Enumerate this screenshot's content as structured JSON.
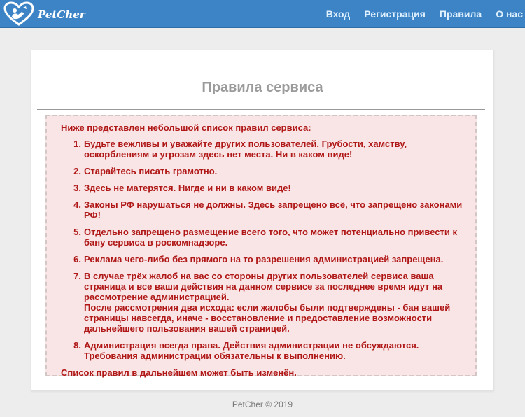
{
  "brand": {
    "name": "PetCher",
    "logo_icon": "heart-pet-logo"
  },
  "nav": {
    "links": [
      "Вход",
      "Регистрация",
      "Правила",
      "О нас"
    ]
  },
  "page": {
    "title": "Правила сервиса"
  },
  "rules": {
    "intro": "Ниже представлен небольшой список правил сервиса:",
    "items": [
      {
        "num": "1.",
        "text": "Будьте вежливы и уважайте других пользователей. Грубости, хамству, оскорблениям и угрозам здесь нет места. Ни в каком виде!"
      },
      {
        "num": "2.",
        "text": "Старайтесь писать грамотно."
      },
      {
        "num": "3.",
        "text": "Здесь не матерятся. Нигде и ни в каком виде!"
      },
      {
        "num": "4.",
        "text": "Законы РФ нарушаться не должны. Здесь запрещено всё, что запрещено законами РФ!"
      },
      {
        "num": "5.",
        "text": "Отдельно запрещено размещение всего того, что может потенциально привести к бану сервиса в роскомнадзоре."
      },
      {
        "num": "6.",
        "text": "Реклама чего-либо без прямого на то разрешения администрацией запрещена."
      },
      {
        "num": "7.",
        "text": "В случае трёх жалоб на вас со стороны других пользователей сервиса ваша страница и все ваши действия на данном сервисе за последнее время идут на рассмотрение администрацией.",
        "text2": "После рассмотрения два исхода: если жалобы были подтверждены - бан вашей страницы навсегда, иначе - восстановление и предоставление возможности дальнейшего пользования вашей страницей."
      },
      {
        "num": "8.",
        "text": "Администрация всегда права. Действия администрации не обсуждаются.",
        "text2": "Требования администрации обязательны к выполнению."
      }
    ],
    "outro": "Список правил в дальнейшем может быть изменён."
  },
  "footer": {
    "text": "PetCher © 2019"
  },
  "colors": {
    "navbar": "#3d84c6",
    "rules_text": "#b01717",
    "rules_bg": "#f9e5e5"
  }
}
